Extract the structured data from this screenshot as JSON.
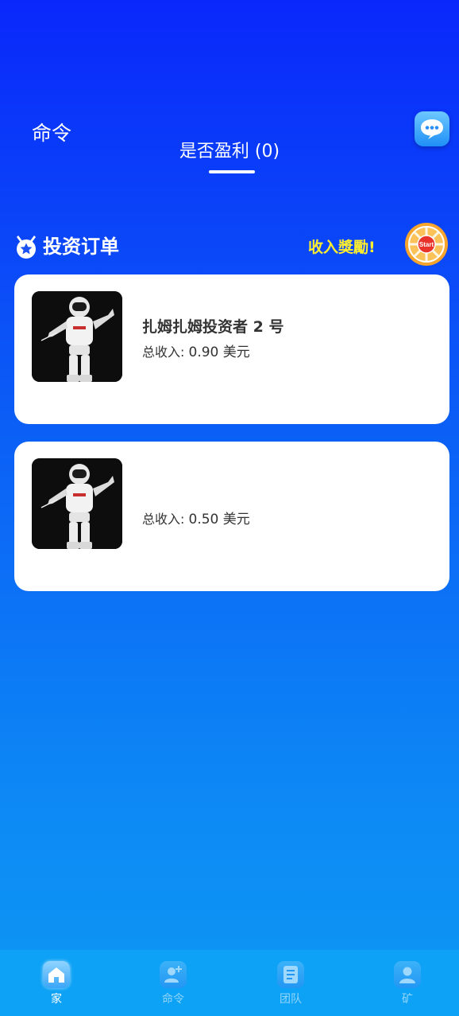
{
  "header": {
    "title": "命令",
    "chat_icon": "chat-bubble-icon"
  },
  "tabs": [
    {
      "label": "是否盈利 (0)",
      "active": true
    }
  ],
  "section": {
    "icon": "medal-icon",
    "title": "投资订单",
    "reward_link": "收入獎勵!",
    "start_button_label": "Start"
  },
  "orders": [
    {
      "name": "扎姆扎姆投资者 2 号",
      "income_label": "总收入:",
      "income_value": "0.90 美元"
    },
    {
      "name": "",
      "income_label": "总收入:",
      "income_value": "0.50 美元"
    }
  ],
  "bottom_nav": [
    {
      "label": "家",
      "icon": "home-icon",
      "active": true
    },
    {
      "label": "命令",
      "icon": "add-user-icon",
      "active": false
    },
    {
      "label": "团队",
      "icon": "document-icon",
      "active": false
    },
    {
      "label": "矿",
      "icon": "user-icon",
      "active": false
    }
  ],
  "colors": {
    "background_top": "#0a27fb",
    "background_bottom": "#0d98f4",
    "reward_text": "#ffee2e",
    "card_bg": "#ffffff",
    "nav_bg": "#0da2f5"
  }
}
